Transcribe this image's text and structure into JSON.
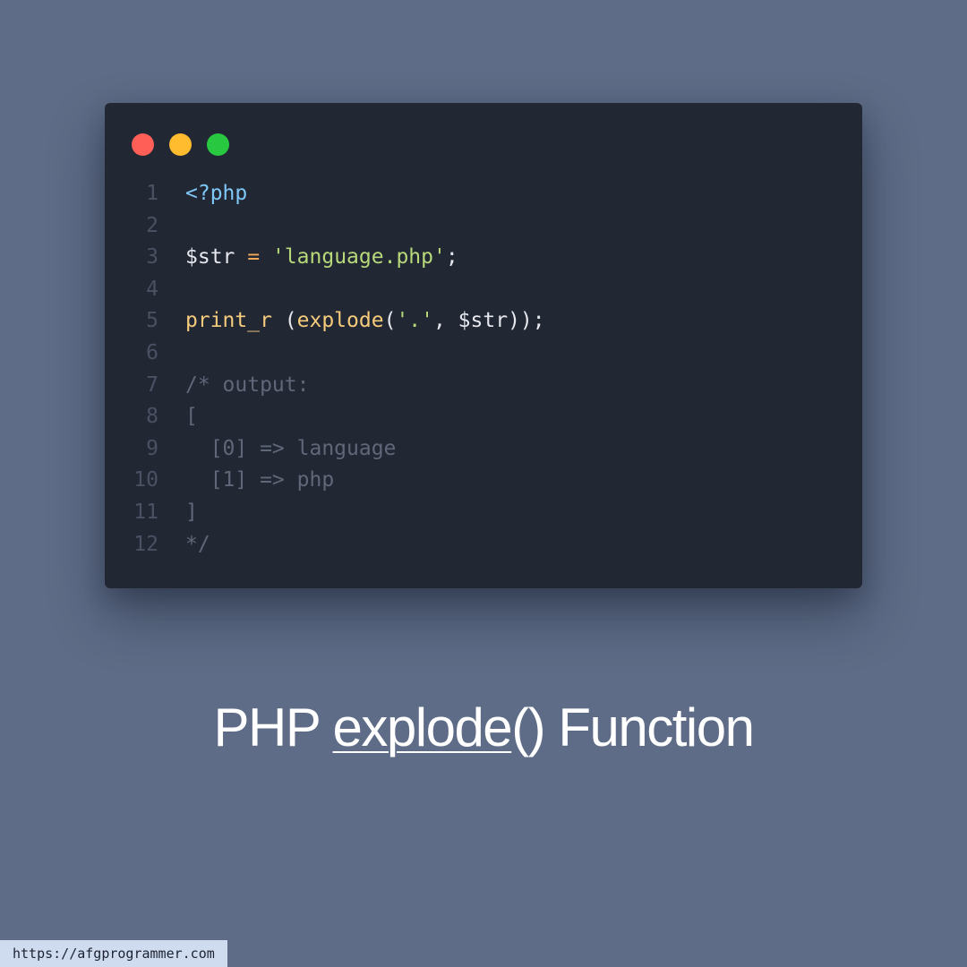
{
  "editor": {
    "window_controls": [
      {
        "name": "close",
        "color": "#ff5f57"
      },
      {
        "name": "minimize",
        "color": "#febc2e"
      },
      {
        "name": "maximize",
        "color": "#28c840"
      }
    ],
    "lines": [
      {
        "number": "1",
        "tokens": [
          {
            "t": "<?php",
            "c": "tag"
          }
        ]
      },
      {
        "number": "2",
        "tokens": []
      },
      {
        "number": "3",
        "tokens": [
          {
            "t": "$str",
            "c": "var"
          },
          {
            "t": " ",
            "c": "punc"
          },
          {
            "t": "=",
            "c": "op"
          },
          {
            "t": " ",
            "c": "punc"
          },
          {
            "t": "'language.php'",
            "c": "str"
          },
          {
            "t": ";",
            "c": "punc"
          }
        ]
      },
      {
        "number": "4",
        "tokens": []
      },
      {
        "number": "5",
        "tokens": [
          {
            "t": "print_r",
            "c": "fn"
          },
          {
            "t": " (",
            "c": "punc"
          },
          {
            "t": "explode",
            "c": "fn"
          },
          {
            "t": "(",
            "c": "punc"
          },
          {
            "t": "'.'",
            "c": "str"
          },
          {
            "t": ", $str));",
            "c": "punc"
          }
        ]
      },
      {
        "number": "6",
        "tokens": []
      },
      {
        "number": "7",
        "tokens": [
          {
            "t": "/* output:",
            "c": "comment"
          }
        ]
      },
      {
        "number": "8",
        "tokens": [
          {
            "t": "[",
            "c": "comment"
          }
        ]
      },
      {
        "number": "9",
        "tokens": [
          {
            "t": "  [0] => language",
            "c": "comment"
          }
        ]
      },
      {
        "number": "10",
        "tokens": [
          {
            "t": "  [1] => php",
            "c": "comment"
          }
        ]
      },
      {
        "number": "11",
        "tokens": [
          {
            "t": "]",
            "c": "comment"
          }
        ]
      },
      {
        "number": "12",
        "tokens": [
          {
            "t": "*/",
            "c": "comment"
          }
        ]
      }
    ]
  },
  "caption": {
    "prefix": "PHP ",
    "function_name": "explode",
    "suffix": "() Function"
  },
  "footer": {
    "url": "https://afgprogrammer.com"
  },
  "colors": {
    "background": "#5e6c87",
    "editor_background": "#222734",
    "tag": "#7fc8f8",
    "string": "#b7d97a",
    "function": "#f6cb7c",
    "operator": "#f0a95a",
    "comment": "#5f6778"
  }
}
